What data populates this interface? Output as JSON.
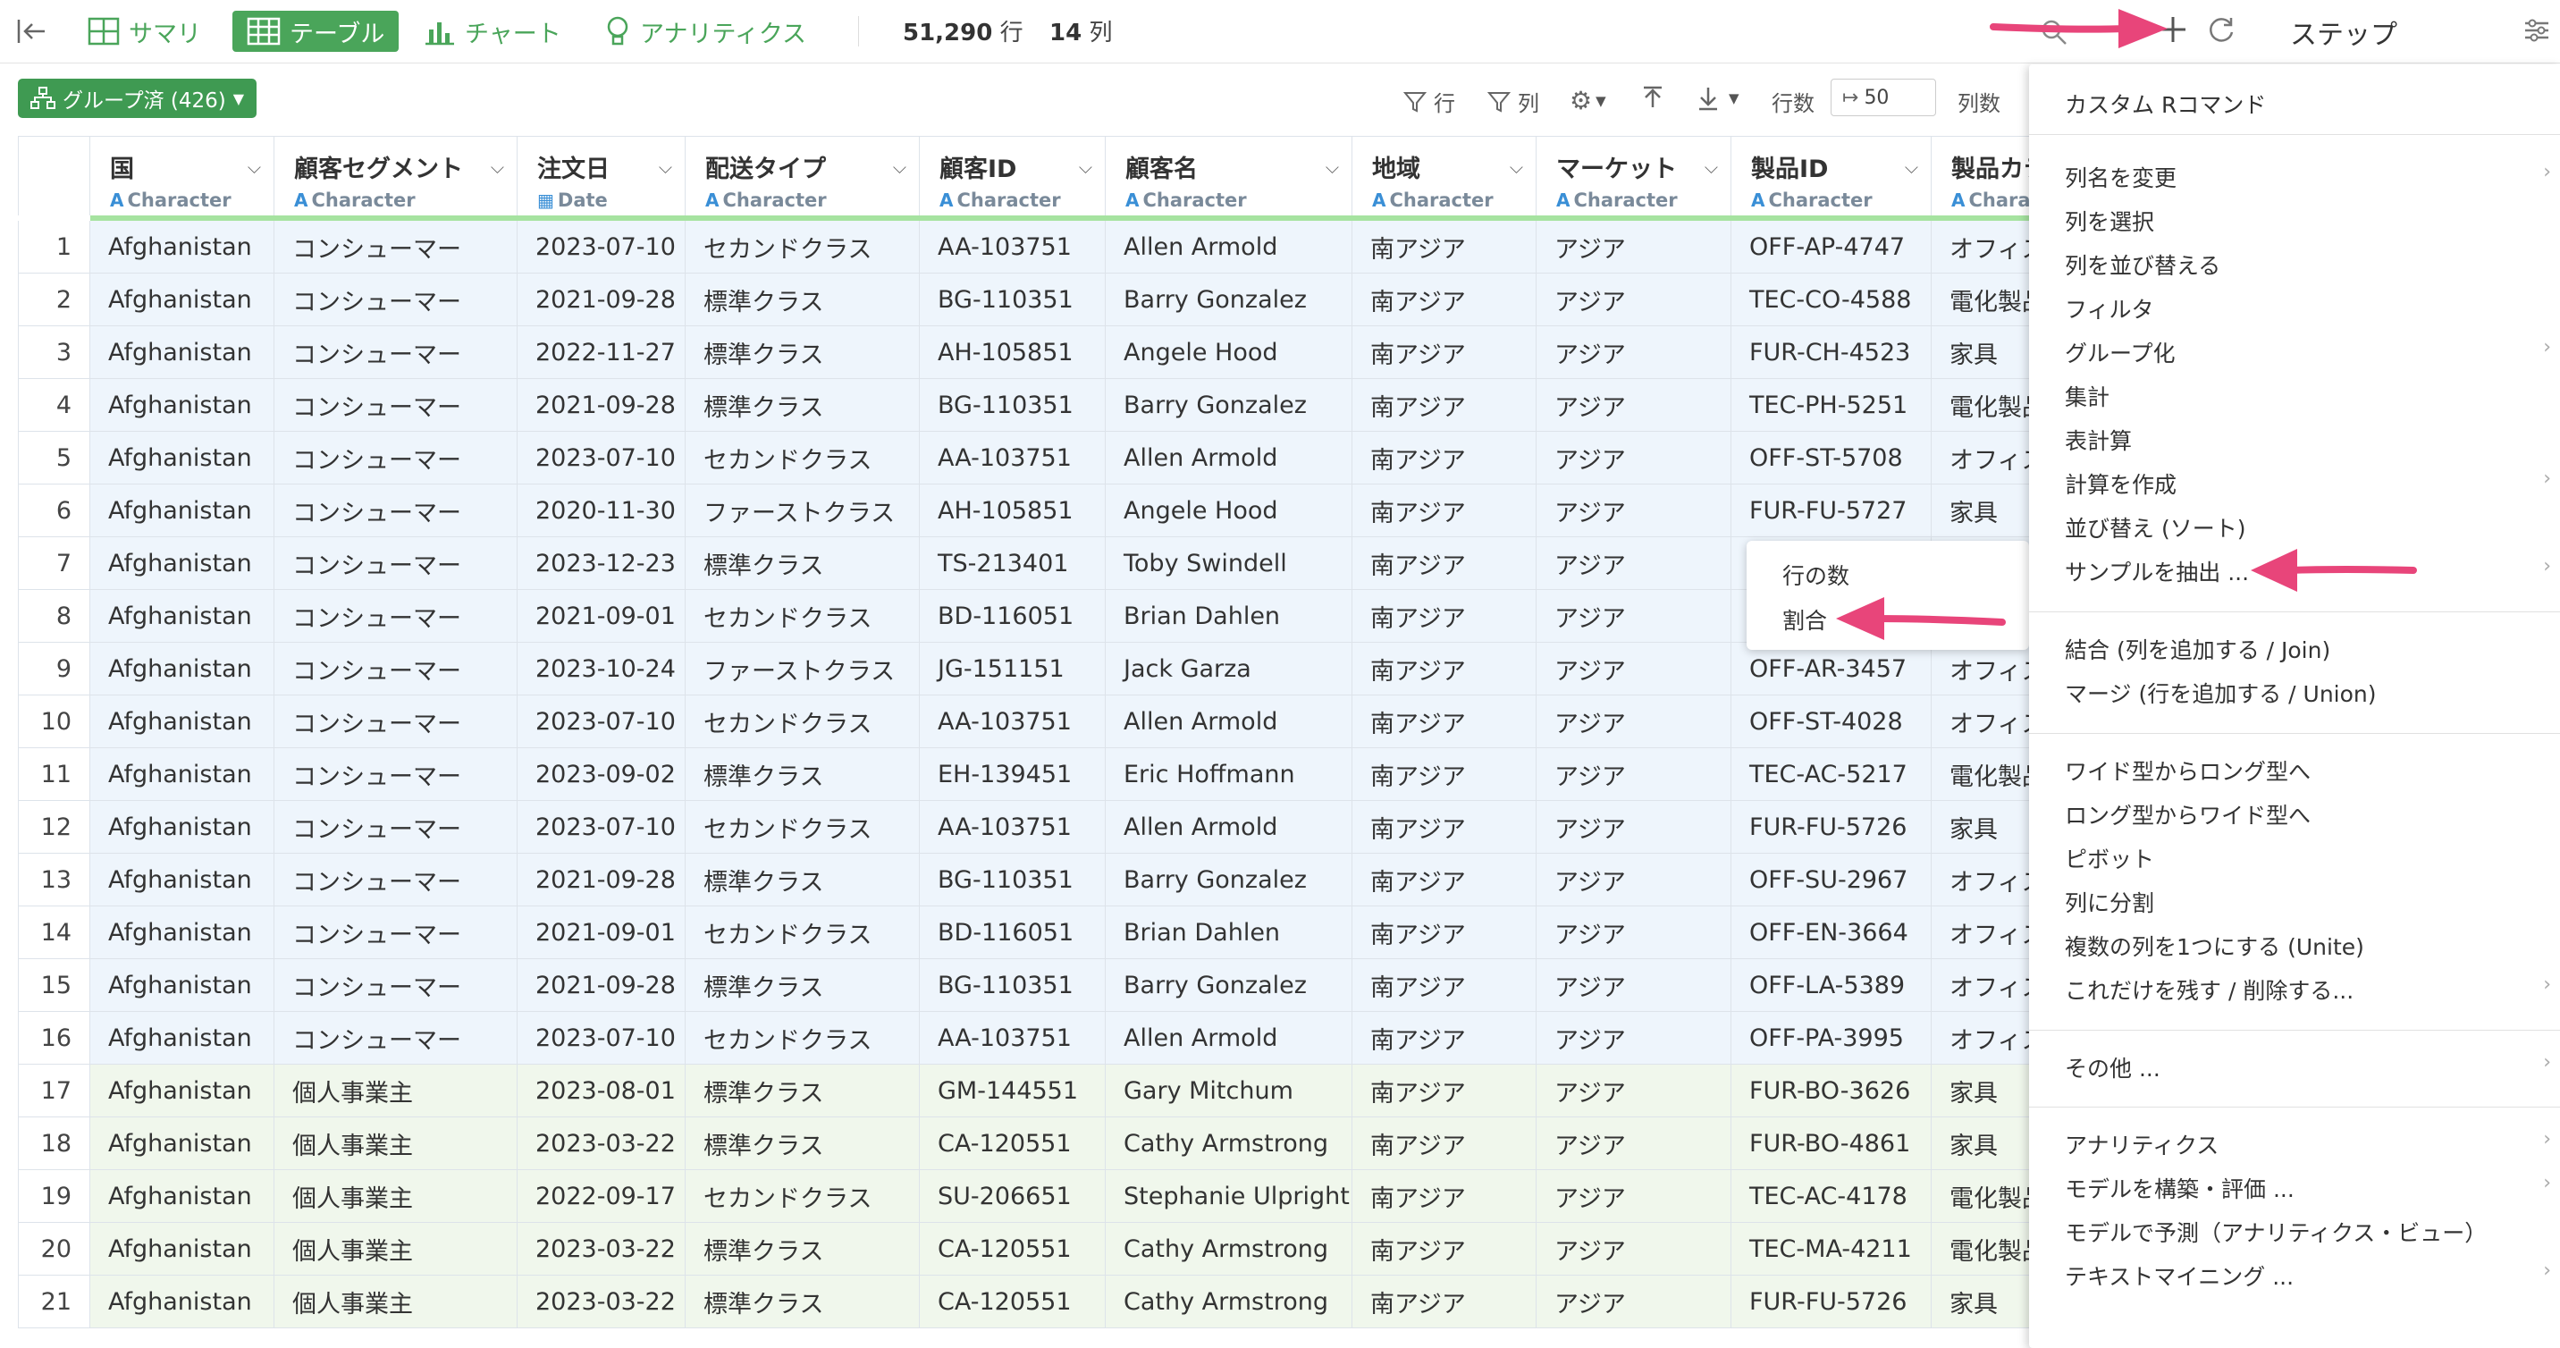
{
  "topbar": {
    "summary": "サマリ",
    "table": "テーブル",
    "chart": "チャート",
    "analytics": "アナリティクス",
    "rows_count": "51,290",
    "rows_unit": "行",
    "cols_count": "14",
    "cols_unit": "列",
    "steps": "ステップ"
  },
  "toolbar": {
    "group_label": "グループ済 (426)",
    "row_filter": "行",
    "col_filter": "列",
    "rows_label": "行数",
    "rows_value": "50",
    "cols_label": "列数"
  },
  "columns": [
    {
      "name": "国",
      "type": "Character"
    },
    {
      "name": "顧客セグメント",
      "type": "Character"
    },
    {
      "name": "注文日",
      "type": "Date"
    },
    {
      "name": "配送タイプ",
      "type": "Character"
    },
    {
      "name": "顧客ID",
      "type": "Character"
    },
    {
      "name": "顧客名",
      "type": "Character"
    },
    {
      "name": "地域",
      "type": "Character"
    },
    {
      "name": "マーケット",
      "type": "Character"
    },
    {
      "name": "製品ID",
      "type": "Character"
    },
    {
      "name": "製品カテ",
      "type": "Chara"
    }
  ],
  "rows": [
    {
      "n": "1",
      "c": [
        "Afghanistan",
        "コンシューマー",
        "2023-07-10",
        "セカンドクラス",
        "AA-103751",
        "Allen Armold",
        "南アジア",
        "アジア",
        "OFF-AP-4747",
        "オフィス"
      ]
    },
    {
      "n": "2",
      "c": [
        "Afghanistan",
        "コンシューマー",
        "2021-09-28",
        "標準クラス",
        "BG-110351",
        "Barry Gonzalez",
        "南アジア",
        "アジア",
        "TEC-CO-4588",
        "電化製品"
      ]
    },
    {
      "n": "3",
      "c": [
        "Afghanistan",
        "コンシューマー",
        "2022-11-27",
        "標準クラス",
        "AH-105851",
        "Angele Hood",
        "南アジア",
        "アジア",
        "FUR-CH-4523",
        "家具"
      ]
    },
    {
      "n": "4",
      "c": [
        "Afghanistan",
        "コンシューマー",
        "2021-09-28",
        "標準クラス",
        "BG-110351",
        "Barry Gonzalez",
        "南アジア",
        "アジア",
        "TEC-PH-5251",
        "電化製品"
      ]
    },
    {
      "n": "5",
      "c": [
        "Afghanistan",
        "コンシューマー",
        "2023-07-10",
        "セカンドクラス",
        "AA-103751",
        "Allen Armold",
        "南アジア",
        "アジア",
        "OFF-ST-5708",
        "オフィス"
      ]
    },
    {
      "n": "6",
      "c": [
        "Afghanistan",
        "コンシューマー",
        "2020-11-30",
        "ファーストクラス",
        "AH-105851",
        "Angele Hood",
        "南アジア",
        "アジア",
        "FUR-FU-5727",
        "家具"
      ]
    },
    {
      "n": "7",
      "c": [
        "Afghanistan",
        "コンシューマー",
        "2023-12-23",
        "標準クラス",
        "TS-213401",
        "Toby Swindell",
        "南アジア",
        "アジア",
        "",
        ""
      ]
    },
    {
      "n": "8",
      "c": [
        "Afghanistan",
        "コンシューマー",
        "2021-09-01",
        "セカンドクラス",
        "BD-116051",
        "Brian Dahlen",
        "南アジア",
        "アジア",
        "",
        ""
      ]
    },
    {
      "n": "9",
      "c": [
        "Afghanistan",
        "コンシューマー",
        "2023-10-24",
        "ファーストクラス",
        "JG-151151",
        "Jack Garza",
        "南アジア",
        "アジア",
        "OFF-AR-3457",
        "オフィス"
      ]
    },
    {
      "n": "10",
      "c": [
        "Afghanistan",
        "コンシューマー",
        "2023-07-10",
        "セカンドクラス",
        "AA-103751",
        "Allen Armold",
        "南アジア",
        "アジア",
        "OFF-ST-4028",
        "オフィス"
      ]
    },
    {
      "n": "11",
      "c": [
        "Afghanistan",
        "コンシューマー",
        "2023-09-02",
        "標準クラス",
        "EH-139451",
        "Eric Hoffmann",
        "南アジア",
        "アジア",
        "TEC-AC-5217",
        "電化製品"
      ]
    },
    {
      "n": "12",
      "c": [
        "Afghanistan",
        "コンシューマー",
        "2023-07-10",
        "セカンドクラス",
        "AA-103751",
        "Allen Armold",
        "南アジア",
        "アジア",
        "FUR-FU-5726",
        "家具"
      ]
    },
    {
      "n": "13",
      "c": [
        "Afghanistan",
        "コンシューマー",
        "2021-09-28",
        "標準クラス",
        "BG-110351",
        "Barry Gonzalez",
        "南アジア",
        "アジア",
        "OFF-SU-2967",
        "オフィス"
      ]
    },
    {
      "n": "14",
      "c": [
        "Afghanistan",
        "コンシューマー",
        "2021-09-01",
        "セカンドクラス",
        "BD-116051",
        "Brian Dahlen",
        "南アジア",
        "アジア",
        "OFF-EN-3664",
        "オフィス"
      ]
    },
    {
      "n": "15",
      "c": [
        "Afghanistan",
        "コンシューマー",
        "2021-09-28",
        "標準クラス",
        "BG-110351",
        "Barry Gonzalez",
        "南アジア",
        "アジア",
        "OFF-LA-5389",
        "オフィス"
      ]
    },
    {
      "n": "16",
      "c": [
        "Afghanistan",
        "コンシューマー",
        "2023-07-10",
        "セカンドクラス",
        "AA-103751",
        "Allen Armold",
        "南アジア",
        "アジア",
        "OFF-PA-3995",
        "オフィス"
      ]
    },
    {
      "n": "17",
      "c": [
        "Afghanistan",
        "個人事業主",
        "2023-08-01",
        "標準クラス",
        "GM-144551",
        "Gary Mitchum",
        "南アジア",
        "アジア",
        "FUR-BO-3626",
        "家具"
      ]
    },
    {
      "n": "18",
      "c": [
        "Afghanistan",
        "個人事業主",
        "2023-03-22",
        "標準クラス",
        "CA-120551",
        "Cathy Armstrong",
        "南アジア",
        "アジア",
        "FUR-BO-4861",
        "家具"
      ]
    },
    {
      "n": "19",
      "c": [
        "Afghanistan",
        "個人事業主",
        "2022-09-17",
        "セカンドクラス",
        "SU-206651",
        "Stephanie Ulpright",
        "南アジア",
        "アジア",
        "TEC-AC-4178",
        "電化製品"
      ]
    },
    {
      "n": "20",
      "c": [
        "Afghanistan",
        "個人事業主",
        "2023-03-22",
        "標準クラス",
        "CA-120551",
        "Cathy Armstrong",
        "南アジア",
        "アジア",
        "TEC-MA-4211",
        "電化製品"
      ]
    },
    {
      "n": "21",
      "c": [
        "Afghanistan",
        "個人事業主",
        "2023-03-22",
        "標準クラス",
        "CA-120551",
        "Cathy Armstrong",
        "南アジア",
        "アジア",
        "FUR-FU-5726",
        "家具"
      ]
    }
  ],
  "submenu": {
    "row_count": "行の数",
    "ratio": "割合"
  },
  "menu": {
    "custom_r": "カスタム Rコマンド",
    "rename": "列名を変更",
    "select": "列を選択",
    "reorder": "列を並び替える",
    "filter": "フィルタ",
    "group": "グループ化",
    "summarize": "集計",
    "table_calc": "表計算",
    "create_calc": "計算を作成",
    "sort": "並び替え (ソート)",
    "sample": "サンプルを抽出 ...",
    "join": "結合 (列を追加する / Join)",
    "union": "マージ (行を追加する / Union)",
    "wide_long": "ワイド型からロング型へ",
    "long_wide": "ロング型からワイド型へ",
    "pivot": "ピボット",
    "split": "列に分割",
    "unite": "複数の列を1つにする (Unite)",
    "keep_remove": "これだけを残す / 削除する...",
    "other": "その他 ...",
    "analytics": "アナリティクス",
    "build_model": "モデルを構築・評価 ...",
    "predict": "モデルで予測（アナリティクス・ビュー）",
    "text_mining": "テキストマイニング ..."
  },
  "colors": {
    "accent": "#4aa55a",
    "arrow": "#e8457a",
    "menu_bg": "#ffffff"
  }
}
